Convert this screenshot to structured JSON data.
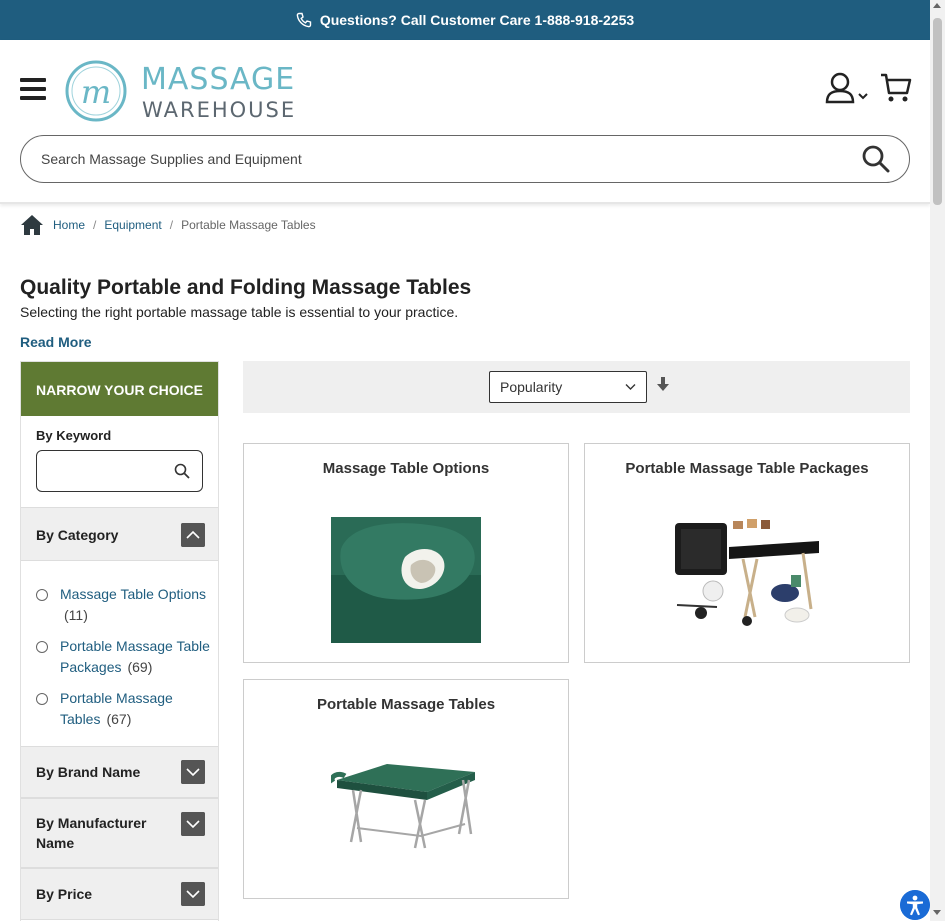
{
  "topbar": {
    "text": "Questions? Call Customer Care 1-888-918-2253",
    "icon": "phone-icon"
  },
  "header": {
    "logo_line1": "MASSAGE",
    "logo_line2": "WAREHOUSE",
    "logo_mark": "m",
    "account_icon": "user-icon",
    "cart_icon": "cart-icon"
  },
  "search": {
    "placeholder": "Search Massage Supplies and Equipment",
    "value": ""
  },
  "breadcrumb": {
    "home": "Home",
    "equipment": "Equipment",
    "current": "Portable Massage Tables",
    "sep": "/"
  },
  "page": {
    "title": "Quality Portable and Folding Massage Tables",
    "subtitle": "Selecting the right portable massage table is essential to your practice.",
    "read_more": "Read More"
  },
  "sidebar": {
    "heading": "NARROW YOUR CHOICE",
    "keyword_label": "By Keyword",
    "keyword_value": "",
    "facets": {
      "category": "By Category",
      "brand": "By Brand Name",
      "manufacturer": "By Manufacturer Name",
      "price": "By Price"
    },
    "categories": [
      {
        "label": "Massage Table Options",
        "count": "(11)"
      },
      {
        "label": "Portable Massage Table Packages",
        "count": "(69)"
      },
      {
        "label": "Portable Massage Tables",
        "count": "(67)"
      }
    ]
  },
  "sort": {
    "selected": "Popularity"
  },
  "cards": [
    {
      "title": "Massage Table Options"
    },
    {
      "title": "Portable Massage Table Packages"
    },
    {
      "title": "Portable Massage Tables"
    }
  ],
  "colors": {
    "topbar": "#1f5d7f",
    "narrow_head": "#5f7a33",
    "link": "#1f5d7f",
    "logo_teal": "#6ab7c6"
  }
}
